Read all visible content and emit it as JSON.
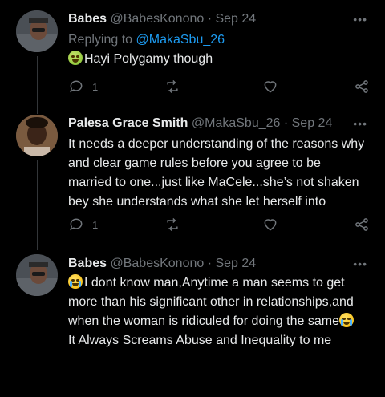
{
  "tweets": [
    {
      "name": "Babes",
      "handle": "@BabesKonono",
      "date": "Sep 24",
      "replying_label": "Replying to",
      "replying_to": "@MakaSbu_26",
      "text": "Hayi Polygamy though",
      "emoji": "nauseated-face-icon",
      "reply_count": "1"
    },
    {
      "name": "Palesa Grace Smith",
      "handle": "@MakaSbu_26",
      "date": "Sep 24",
      "text_lines": [
        "It needs a deeper understanding of the reasons why",
        "and clear game rules before you agree to be",
        "married to one...just like MaCele...she’s not shaken",
        "bey she understands what she let herself into"
      ],
      "reply_count": "1"
    },
    {
      "name": "Babes",
      "handle": "@BabesKonono",
      "date": "Sep 24",
      "text_lines": [
        "I dont know man,Anytime a man seems to get",
        "more than his significant other in relationships,and",
        "when the woman is ridiculed for doing the same",
        "It Always Screams Abuse and Inequality to me"
      ],
      "emoji": "loudly-crying-face-icon"
    }
  ],
  "ui": {
    "more": "•••",
    "sep": " · "
  },
  "colors": {
    "background": "#000000",
    "text": "#e7e9ea",
    "muted": "#71767b",
    "link": "#1d9bf0"
  }
}
